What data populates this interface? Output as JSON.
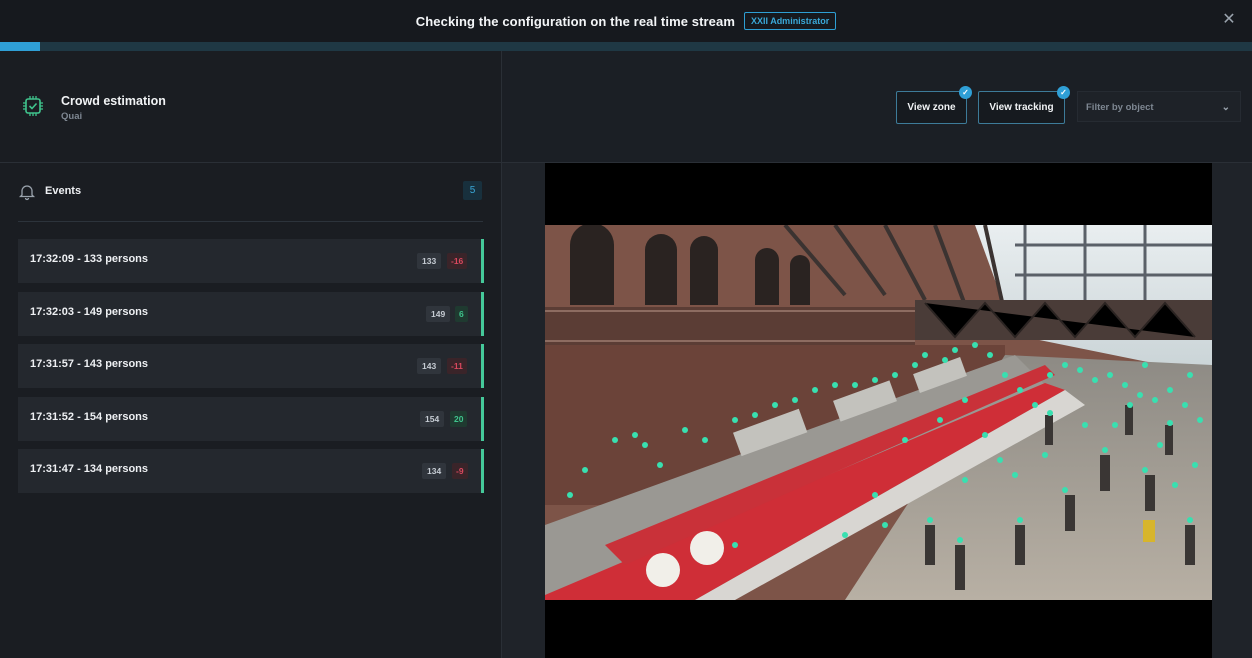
{
  "topbar": {
    "title": "Checking the configuration on the real time stream",
    "badge": "XXII Administrator",
    "close_icon": "close-icon",
    "progress_percent": 3.2
  },
  "widget": {
    "title": "Crowd estimation",
    "subtitle": "Quai",
    "icon": "chip-check-icon",
    "accent": "#3fc48d"
  },
  "events": {
    "label": "Events",
    "count": "5",
    "items": [
      {
        "time_label": "17:32:09  -  133 persons",
        "count": "133",
        "delta": "-16",
        "delta_sign": "neg"
      },
      {
        "time_label": "17:32:03  -  149 persons",
        "count": "149",
        "delta": "6",
        "delta_sign": "pos"
      },
      {
        "time_label": "17:31:57  -  143 persons",
        "count": "143",
        "delta": "-11",
        "delta_sign": "neg"
      },
      {
        "time_label": "17:31:52  -  154 persons",
        "count": "154",
        "delta": "20",
        "delta_sign": "pos"
      },
      {
        "time_label": "17:31:47  -  134 persons",
        "count": "134",
        "delta": "-9",
        "delta_sign": "neg"
      }
    ]
  },
  "toolbar": {
    "view_zone": "View zone",
    "view_tracking": "View tracking",
    "filter_placeholder": "Filter by object"
  },
  "colors": {
    "accent_blue": "#2f9fd6",
    "accent_green": "#45c99a",
    "negative": "#d9485e"
  }
}
